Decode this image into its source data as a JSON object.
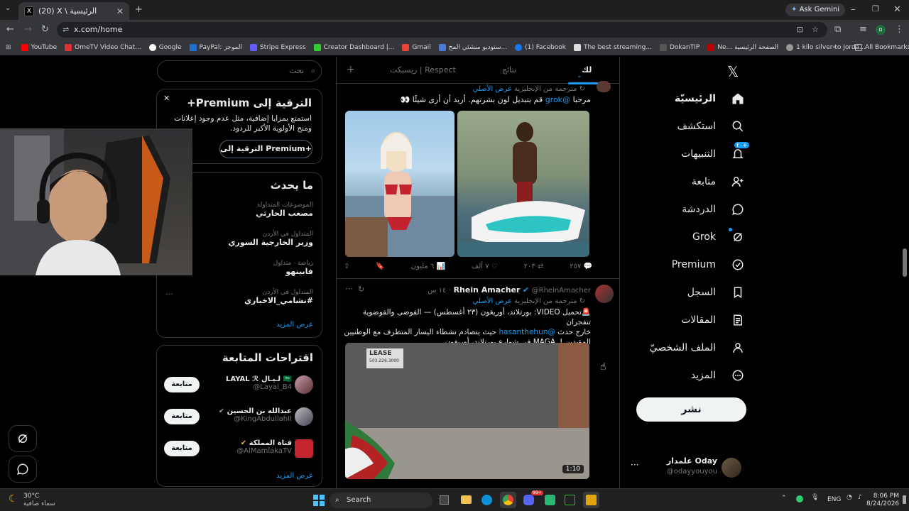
{
  "browser": {
    "tab_title": "(20) X \\ الرئيسية",
    "ask_gemini": "Ask Gemini",
    "url": "x.com/home",
    "bookmarks": [
      "YouTube",
      "OmeTV Video Chat...",
      "Google",
      "PayPal: الموجز",
      "Stripe Express",
      "Creator Dashboard |...",
      "Gmail",
      "ستوديو منشئي المح...",
      "(1) Facebook",
      "The best streaming...",
      "DokanTIP",
      "Ne... الصفحة الرئيسية",
      "1 kilo silver to Jorda..."
    ],
    "all_bookmarks": "All Bookmarks"
  },
  "nav": {
    "home": "الرئيسيّة",
    "explore": "استكشف",
    "notifications": "التنبيهات",
    "notifications_badge": "+٢٠",
    "follow": "متابعة",
    "chat": "الدردشة",
    "grok": "Grok",
    "premium": "Premium",
    "bookmarks": "السجل",
    "articles": "المقالات",
    "profile": "الملف الشخصيّ",
    "more": "المزيد",
    "post": "نشر",
    "account_name": "Oday علمدار",
    "account_handle": "@odayyouyou"
  },
  "feed": {
    "tab_for_you": "لك",
    "tab_results": "نتائج",
    "tab_respect": "ريسبكت | Respect",
    "post1": {
      "translated": "مترجمة من الإنجليزية",
      "show_original": "عرض الأصلي",
      "text_prefix": "مرحبا",
      "text_mention": "@grok",
      "text_suffix": "قم بتبديل لون بشرتهم. أريد أن أرى شيئًا 👀",
      "replies": "٢٥٧",
      "reposts": "٢٠٣",
      "likes": "٧ ألف",
      "views": "٦ مليون"
    },
    "post2": {
      "name": "Rhein Amacher",
      "handle": "@RheinAmacher",
      "time": "١٤ س",
      "translated": "مترجمة من الإنجليزية",
      "show_original": "عرض الأصلي",
      "line1": "🚨تحميل VIDEO: بورتلاند، أوريغون (٢٣ أغسطس) — الفوضى والفوضوية تنفجران",
      "line2_prefix": "خارج حدث",
      "line2_mention": "@hasanthehun",
      "line2_suffix": "حيث يتصادم نشطاء اليسار المتطرف مع الوطنيين",
      "line3": "المؤيدين لـ MAGA في شوارع بورتلاند، أوريغون.",
      "video_duration": "1:10",
      "sign_text": "LEASE",
      "sign_phone": "503.226.3000"
    }
  },
  "sidebar": {
    "search_placeholder": "بحث",
    "premium_title": "الترقية إلى Premium+",
    "premium_text": "استمتع بمزايا إضافية، مثل عدم وجود إعلانات ومنح الأولوية الأكبر للردود.",
    "premium_button": "الترقية إلى Premium+",
    "trends_title": "ما يحدث",
    "trends": [
      {
        "context": "الموضوعات المتداولة",
        "topic": "مصعب الحارثي"
      },
      {
        "context": "المتداول في الأردن",
        "topic": "وزير الخارجية السوري"
      },
      {
        "context": "رياضة · متداول",
        "topic": "فابينهو"
      },
      {
        "context": "المتداول في الأردن",
        "topic": "#نشامي_الاخباري"
      }
    ],
    "show_more": "عرض المزيد",
    "who_to_follow_title": "اقتراحات المتابعة",
    "suggestions": [
      {
        "name": "LAYAL ℛ لـيـال 🇸🇦",
        "handle": "@Layal_B4",
        "button": "متابعة"
      },
      {
        "name": "عبدالله بن الحسين",
        "handle": "@KingAbdullahII",
        "button": "متابعة"
      },
      {
        "name": "قناة المملكة",
        "handle": "@AlMamlakaTV",
        "button": "متابعة"
      }
    ],
    "show_more_2": "عرض المزيد"
  },
  "taskbar": {
    "temp": "30°C",
    "weather": "سماء صافية",
    "search": "Search",
    "lang": "ENG",
    "time": "8:06 PM",
    "date": "8/24/2026",
    "badge": "99+"
  }
}
